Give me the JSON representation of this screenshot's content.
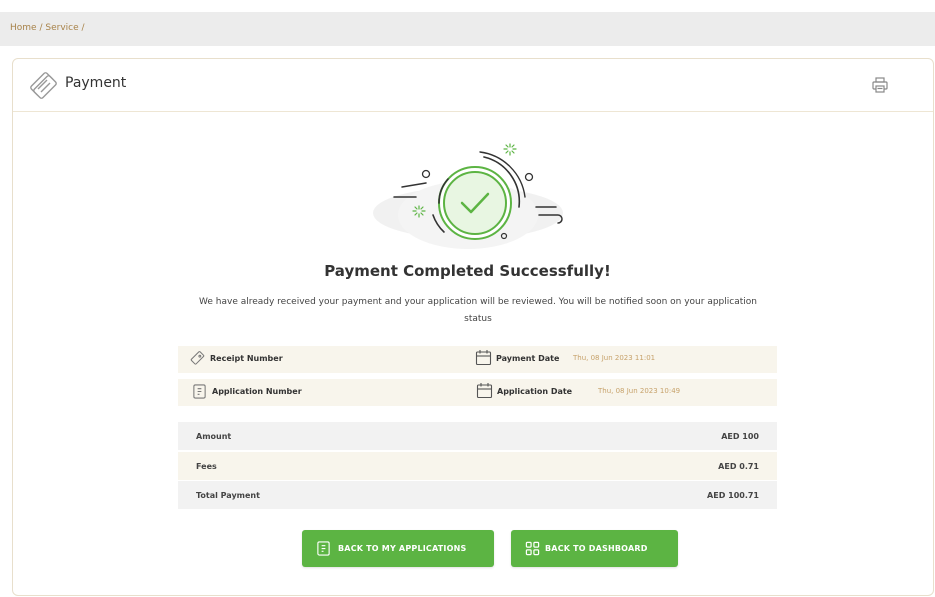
{
  "breadcrumb": {
    "home": "Home",
    "sep1": "/",
    "service": "Service",
    "sep2": "/"
  },
  "header": {
    "title": "Payment",
    "icon": "payment-card-icon",
    "print_icon": "printer-icon"
  },
  "success": {
    "title": "Payment Completed Successfully!",
    "message": "We have already received your payment and your application will be reviewed. You will be notified soon on your application status"
  },
  "details": {
    "receipt_label": "Receipt Number",
    "payment_date_label": "Payment Date",
    "payment_date_value": "Thu, 08 Jun 2023 11:01",
    "application_label": "Application Number",
    "application_date_label": "Application Date",
    "application_date_value": "Thu, 08 Jun 2023 10:49"
  },
  "summary": {
    "rows": [
      {
        "label": "Amount",
        "value": "AED 100"
      },
      {
        "label": "Fees",
        "value": "AED 0.71"
      },
      {
        "label": "Total Payment",
        "value": "AED 100.71"
      }
    ]
  },
  "buttons": {
    "back_applications": "BACK TO MY APPLICATIONS",
    "back_dashboard": "BACK TO DASHBOARD"
  },
  "colors": {
    "accent_green": "#5cb443",
    "gold_text": "#c7a26b",
    "row_beige": "#f8f5ec",
    "row_gray": "#f2f2f2"
  }
}
